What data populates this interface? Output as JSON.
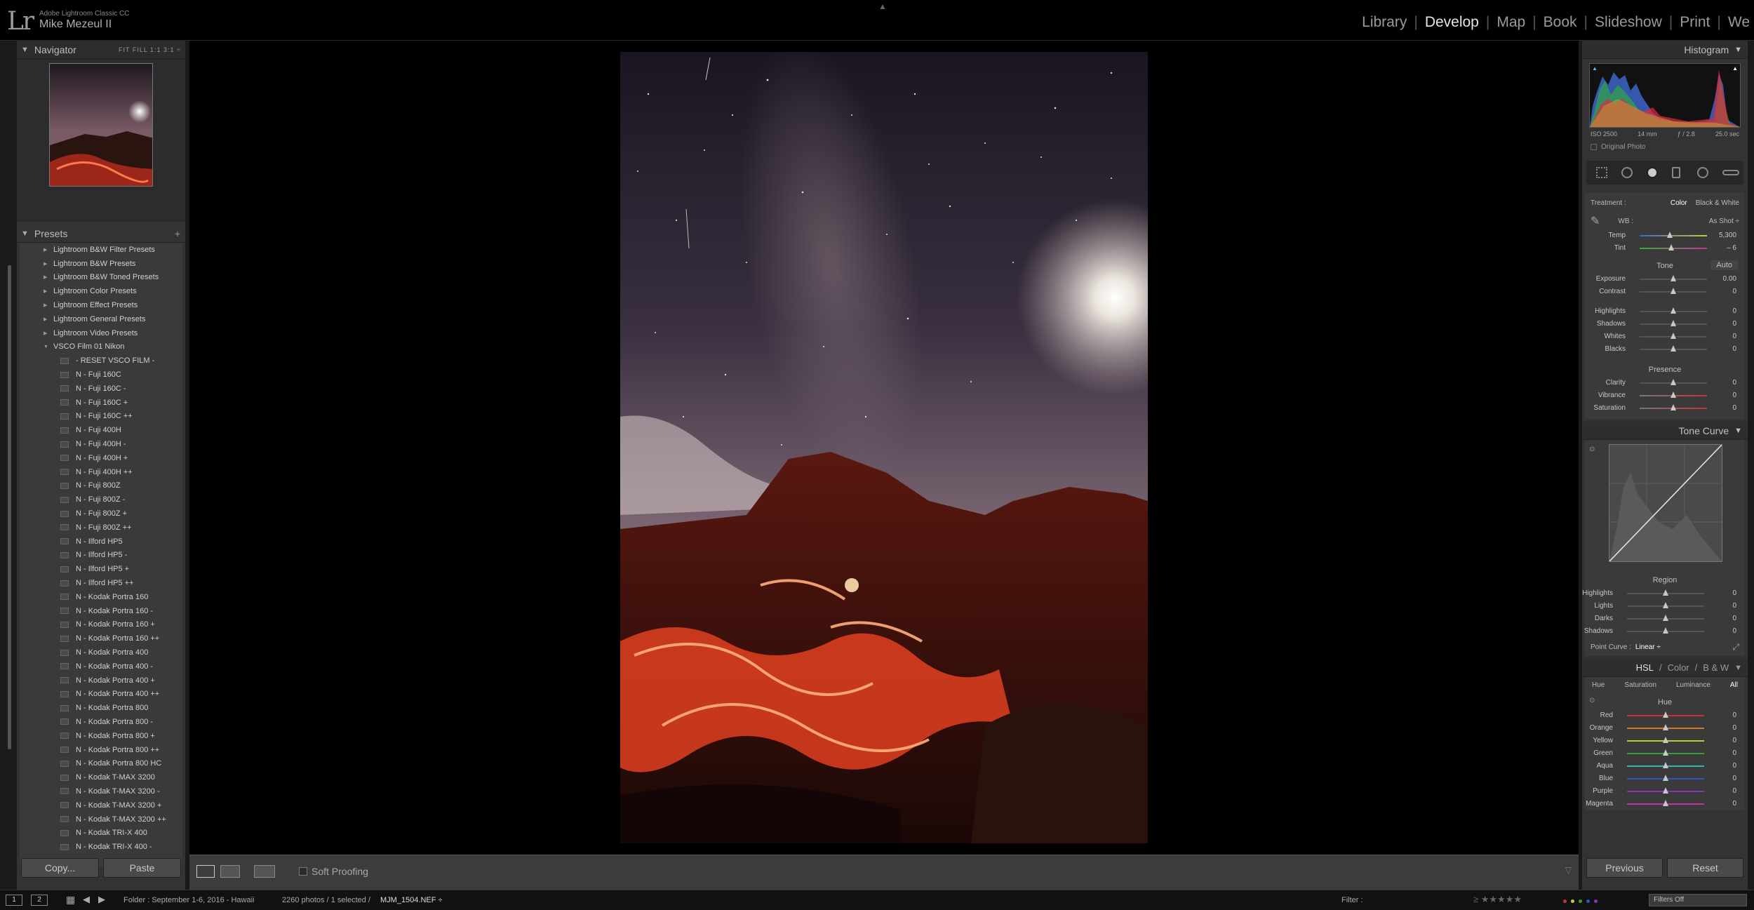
{
  "app": {
    "logo": "Lr",
    "name": "Adobe Lightroom Classic CC",
    "user": "Mike Mezeul II"
  },
  "modules": [
    {
      "label": "Library",
      "active": false
    },
    {
      "label": "Develop",
      "active": true
    },
    {
      "label": "Map",
      "active": false
    },
    {
      "label": "Book",
      "active": false
    },
    {
      "label": "Slideshow",
      "active": false
    },
    {
      "label": "Print",
      "active": false
    },
    {
      "label": "We",
      "active": false
    }
  ],
  "navigator": {
    "title": "Navigator",
    "options": "FIT  FILL  1:1  3:1 ÷"
  },
  "presets": {
    "title": "Presets",
    "add": "+",
    "groups": [
      "Lightroom B&W Filter Presets",
      "Lightroom B&W Presets",
      "Lightroom B&W Toned Presets",
      "Lightroom Color Presets",
      "Lightroom Effect Presets",
      "Lightroom General Presets",
      "Lightroom Video Presets"
    ],
    "open_group": "VSCO Film 01 Nikon",
    "items": [
      "- RESET VSCO FILM -",
      "N - Fuji 160C",
      "N - Fuji 160C -",
      "N - Fuji 160C +",
      "N - Fuji 160C ++",
      "N - Fuji 400H",
      "N - Fuji 400H -",
      "N - Fuji 400H +",
      "N - Fuji 400H ++",
      "N - Fuji 800Z",
      "N - Fuji 800Z -",
      "N - Fuji 800Z +",
      "N - Fuji 800Z ++",
      "N - Ilford HP5",
      "N - Ilford HP5 -",
      "N - Ilford HP5 +",
      "N - Ilford HP5 ++",
      "N - Kodak Portra 160",
      "N - Kodak Portra 160 -",
      "N - Kodak Portra 160 +",
      "N - Kodak Portra 160 ++",
      "N - Kodak Portra 400",
      "N - Kodak Portra 400 -",
      "N - Kodak Portra 400 +",
      "N - Kodak Portra 400 ++",
      "N - Kodak Portra 800",
      "N - Kodak Portra 800 -",
      "N - Kodak Portra 800 +",
      "N - Kodak Portra 800 ++",
      "N - Kodak Portra 800 HC",
      "N - Kodak T-MAX 3200",
      "N - Kodak T-MAX 3200 -",
      "N - Kodak T-MAX 3200 +",
      "N - Kodak T-MAX 3200 ++",
      "N - Kodak TRI-X 400",
      "N - Kodak TRI-X 400 -"
    ]
  },
  "left_buttons": {
    "copy": "Copy...",
    "paste": "Paste"
  },
  "toolbar": {
    "soft_proofing": "Soft Proofing"
  },
  "histogram": {
    "title": "Histogram",
    "iso": "ISO 2500",
    "focal": "14 mm",
    "aperture": "ƒ / 2.8",
    "shutter": "25.0 sec",
    "original_photo": "Original Photo"
  },
  "basic": {
    "treatment_label": "Treatment :",
    "color": "Color",
    "bw": "Black & White",
    "wb_label": "WB :",
    "wb_value": "As Shot ÷",
    "temp": {
      "label": "Temp",
      "value": "5,300",
      "level": 0.45
    },
    "tint": {
      "label": "Tint",
      "value": "– 6",
      "level": 0.47
    },
    "tone_label": "Tone",
    "auto": "Auto",
    "tone": [
      {
        "label": "Exposure",
        "value": "0.00",
        "level": 0.5
      },
      {
        "label": "Contrast",
        "value": "0",
        "level": 0.5
      }
    ],
    "tone2": [
      {
        "label": "Highlights",
        "value": "0",
        "level": 0.5
      },
      {
        "label": "Shadows",
        "value": "0",
        "level": 0.5
      },
      {
        "label": "Whites",
        "value": "0",
        "level": 0.5
      },
      {
        "label": "Blacks",
        "value": "0",
        "level": 0.5
      }
    ],
    "presence_label": "Presence",
    "presence": [
      {
        "label": "Clarity",
        "value": "0",
        "level": 0.5
      },
      {
        "label": "Vibrance",
        "value": "0",
        "level": 0.5
      },
      {
        "label": "Saturation",
        "value": "0",
        "level": 0.5
      }
    ]
  },
  "tone_curve": {
    "title": "Tone Curve",
    "region": "Region",
    "regions": [
      {
        "label": "Highlights",
        "value": "0",
        "level": 0.5
      },
      {
        "label": "Lights",
        "value": "0",
        "level": 0.5
      },
      {
        "label": "Darks",
        "value": "0",
        "level": 0.5
      },
      {
        "label": "Shadows",
        "value": "0",
        "level": 0.5
      }
    ],
    "point_curve_label": "Point Curve :",
    "point_curve_value": "Linear ÷"
  },
  "hsl": {
    "tabs": [
      "HSL",
      "/",
      "Color",
      "/",
      "B & W"
    ],
    "sub": [
      "Hue",
      "Saturation",
      "Luminance",
      "All"
    ],
    "hue_label": "Hue",
    "hues": [
      {
        "label": "Red",
        "value": "0",
        "level": 0.5,
        "color": "#c83232"
      },
      {
        "label": "Orange",
        "value": "0",
        "level": 0.5,
        "color": "#d27828"
      },
      {
        "label": "Yellow",
        "value": "0",
        "level": 0.5,
        "color": "#c8c832"
      },
      {
        "label": "Green",
        "value": "0",
        "level": 0.5,
        "color": "#32a032"
      },
      {
        "label": "Aqua",
        "value": "0",
        "level": 0.5,
        "color": "#32b4b4"
      },
      {
        "label": "Blue",
        "value": "0",
        "level": 0.5,
        "color": "#3250c8"
      },
      {
        "label": "Purple",
        "value": "0",
        "level": 0.5,
        "color": "#8c32b4"
      },
      {
        "label": "Magenta",
        "value": "0",
        "level": 0.5,
        "color": "#c832a0"
      }
    ]
  },
  "right_buttons": {
    "previous": "Previous",
    "reset": "Reset"
  },
  "filmstrip": {
    "page1": "1",
    "page2": "2",
    "source": "Folder : September 1-6, 2016 - Hawaii",
    "count": "2260 photos / 1 selected /",
    "filename": "MJM_1504.NEF ÷",
    "filter_label": "Filter :",
    "filters_off": "Filters Off"
  }
}
